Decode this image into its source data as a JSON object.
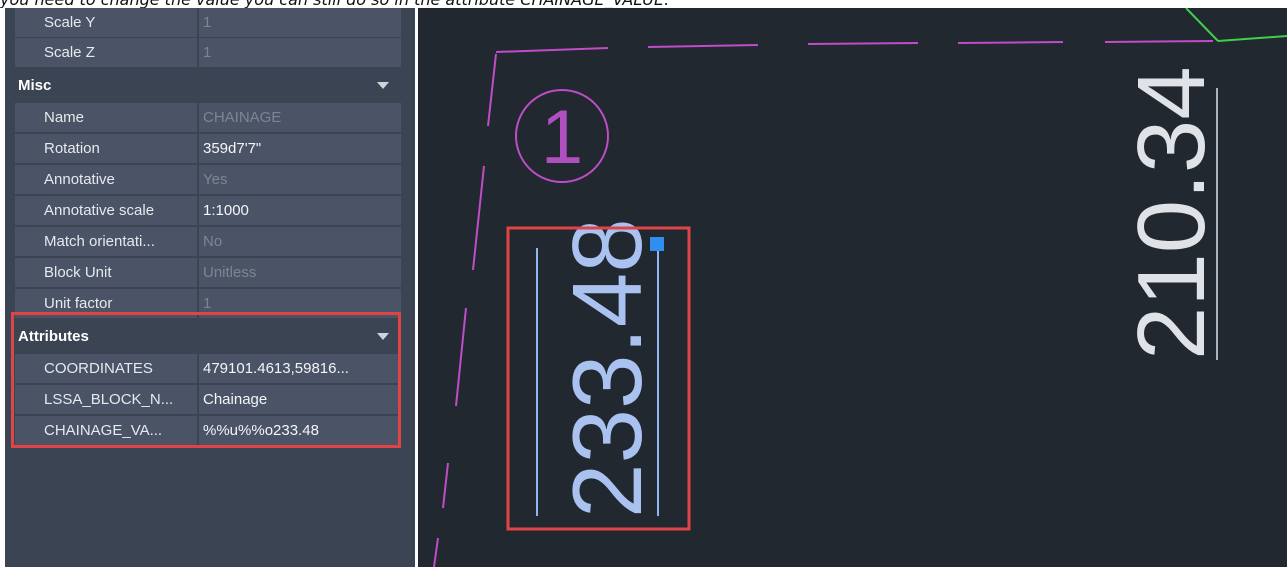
{
  "caption": "you need to change the value you can still do so in the attribute CHAINAGE_VALUE.",
  "panel": {
    "rows_top": [
      {
        "label": "Scale Y",
        "value": "1",
        "dim": true
      },
      {
        "label": "Scale Z",
        "value": "1",
        "dim": true
      }
    ],
    "misc": {
      "title": "Misc",
      "rows": [
        {
          "label": "Name",
          "value": "CHAINAGE",
          "dim": true
        },
        {
          "label": "Rotation",
          "value": "359d7'7\"",
          "dim": false
        },
        {
          "label": "Annotative",
          "value": "Yes",
          "dim": true
        },
        {
          "label": "Annotative scale",
          "value": "1:1000",
          "dim": false
        },
        {
          "label": "Match orientati...",
          "value": "No",
          "dim": true
        },
        {
          "label": "Block Unit",
          "value": "Unitless",
          "dim": true
        },
        {
          "label": "Unit factor",
          "value": "1",
          "dim": true
        }
      ]
    },
    "attributes": {
      "title": "Attributes",
      "rows": [
        {
          "label": "COORDINATES",
          "value": "479101.4613,59816...",
          "dim": false
        },
        {
          "label": "LSSA_BLOCK_N...",
          "value": "Chainage",
          "dim": false
        },
        {
          "label": "CHAINAGE_VA...",
          "value": "%%u%%o233.48",
          "dim": false
        }
      ]
    }
  },
  "drawing": {
    "point_number": "1",
    "chainage_text": "233.48",
    "distance_text": "210.34"
  },
  "colors": {
    "panel_bg": "#3b4453",
    "canvas_bg": "#212830",
    "highlight_red": "#e04444",
    "magenta_line": "#c04cc6",
    "text_white": "#e8ebef",
    "selection_blue": "#2f8ef0",
    "chainage_blue": "#a9c2f0"
  }
}
